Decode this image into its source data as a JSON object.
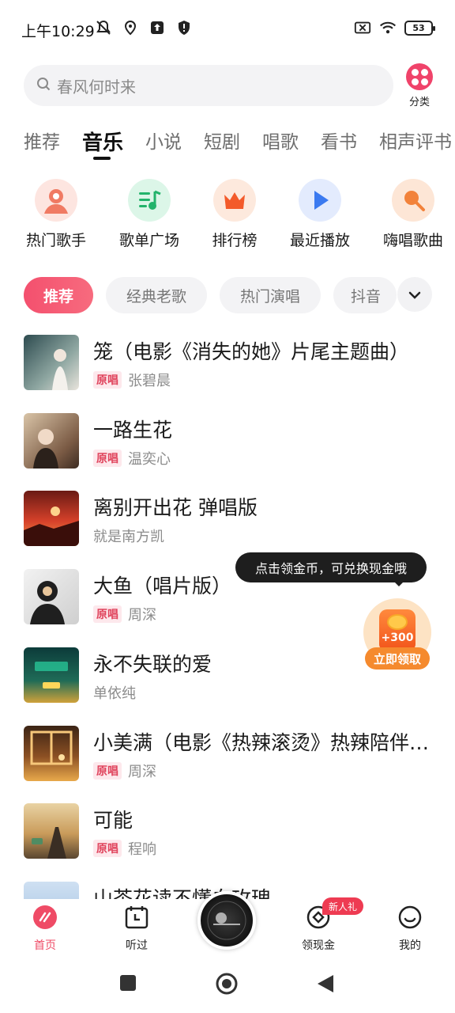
{
  "status_bar": {
    "time": "上午10:29",
    "battery": "53"
  },
  "search": {
    "placeholder": "春风何时来"
  },
  "category": {
    "label": "分类"
  },
  "tabs": [
    "推荐",
    "音乐",
    "小说",
    "短剧",
    "唱歌",
    "看书",
    "相声评书"
  ],
  "active_tab": "音乐",
  "quick_entries": [
    {
      "label": "热门歌手",
      "icon": "singer-icon"
    },
    {
      "label": "歌单广场",
      "icon": "playlist-icon"
    },
    {
      "label": "排行榜",
      "icon": "crown-icon"
    },
    {
      "label": "最近播放",
      "icon": "play-icon"
    },
    {
      "label": "嗨唱歌曲",
      "icon": "microphone-icon"
    }
  ],
  "chips": [
    "推荐",
    "经典老歌",
    "热门演唱",
    "抖音"
  ],
  "songs": [
    {
      "title": "笼（电影《消失的她》片尾主题曲）",
      "tag": "原唱",
      "artist": "张碧晨"
    },
    {
      "title": "一路生花",
      "tag": "原唱",
      "artist": "温奕心"
    },
    {
      "title": "离别开出花 弹唱版",
      "tag": "",
      "artist": "就是南方凯"
    },
    {
      "title": "大鱼（唱片版）",
      "tag": "原唱",
      "artist": "周深"
    },
    {
      "title": "永不失联的爱",
      "tag": "",
      "artist": "单依纯"
    },
    {
      "title": "小美满（电影《热辣滚烫》热辣陪伴曲）",
      "tag": "原唱",
      "artist": "周深"
    },
    {
      "title": "可能",
      "tag": "原唱",
      "artist": "程响"
    },
    {
      "title": "山茶花读不懂白玫瑰",
      "tag": "",
      "artist": ""
    }
  ],
  "reward": {
    "tooltip": "点击领金币，可兑换现金哦",
    "amount": "+300",
    "button": "立即领取"
  },
  "bottom_nav": {
    "home": "首页",
    "history": "听过",
    "earn": "领现金",
    "earn_badge": "新人礼",
    "mine": "我的"
  },
  "colors": {
    "accent": "#ef4b66",
    "reward": "#f58a2e"
  }
}
